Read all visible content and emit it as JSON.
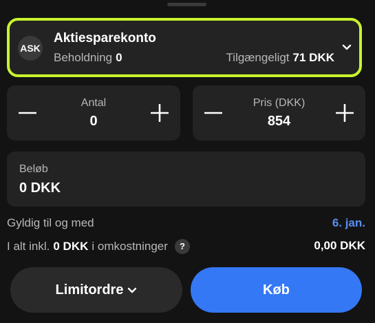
{
  "account": {
    "badge": "ASK",
    "name": "Aktiesparekonto",
    "holding_label": "Beholdning",
    "holding_value": "0",
    "available_label": "Tilgængeligt",
    "available_value": "71 DKK",
    "highlight_color": "#c9f32e"
  },
  "quantity": {
    "label": "Antal",
    "value": "0"
  },
  "price": {
    "label": "Pris (DKK)",
    "value": "854"
  },
  "amount": {
    "label": "Beløb",
    "value": "0 DKK"
  },
  "validity": {
    "label": "Gyldig til og med",
    "value": "6. jan."
  },
  "total": {
    "prefix": "I alt inkl.",
    "cost_value": "0 DKK",
    "suffix": "i omkostninger",
    "help_icon": "?",
    "value": "0,00 DKK"
  },
  "order_type": {
    "label": "Limitordre"
  },
  "buy": {
    "label": "Køb",
    "color": "#3478f6"
  }
}
